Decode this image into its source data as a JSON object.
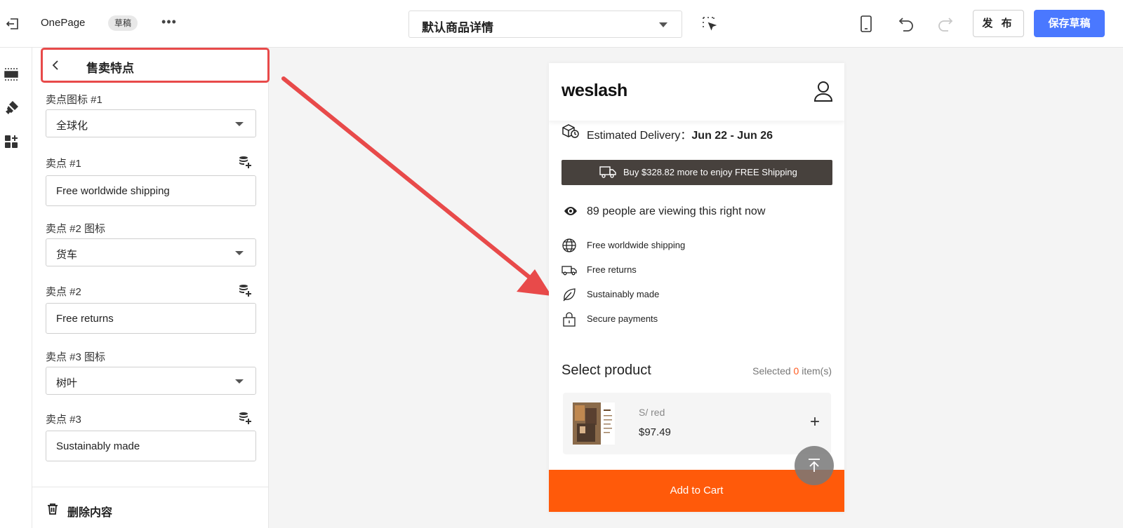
{
  "topbar": {
    "app_name": "OnePage",
    "status_badge": "草稿",
    "more": "•••",
    "template_select": "默认商品详情",
    "publish_label": "发 布",
    "save_draft_label": "保存草稿"
  },
  "panel": {
    "title": "售卖特点",
    "fields": {
      "icon1_label": "卖点图标 #1",
      "icon1_value": "全球化",
      "point1_label": "卖点 #1",
      "point1_value": "Free worldwide shipping",
      "icon2_label": "卖点 #2 图标",
      "icon2_value": "货车",
      "point2_label": "卖点 #2",
      "point2_value": "Free returns",
      "icon3_label": "卖点 #3 图标",
      "icon3_value": "树叶",
      "point3_label": "卖点 #3",
      "point3_value": "Sustainably made"
    },
    "delete_label": "删除内容"
  },
  "preview": {
    "logo": "weslash",
    "delivery_label": "Estimated Delivery：",
    "delivery_value": "Jun 22 - Jun 26",
    "shipping_banner": "Buy $328.82 more to enjoy FREE Shipping",
    "viewers": "89 people are viewing this right now",
    "features": [
      {
        "icon": "globe-icon",
        "text": "Free worldwide shipping"
      },
      {
        "icon": "truck-icon",
        "text": "Free returns"
      },
      {
        "icon": "leaf-icon",
        "text": "Sustainably made"
      },
      {
        "icon": "lock-icon",
        "text": "Secure payments"
      }
    ],
    "select_title": "Select product",
    "selected_prefix": "Selected",
    "selected_count": "0",
    "selected_suffix": "item(s)",
    "item_variant": "S/ red",
    "item_price": "$97.49",
    "item_add": "+",
    "add_to_cart": "Add to Cart"
  },
  "colors": {
    "accent": "#4a78ff",
    "highlight": "#e84a4a",
    "cart": "#ff5a0a",
    "banner": "#47413d"
  }
}
